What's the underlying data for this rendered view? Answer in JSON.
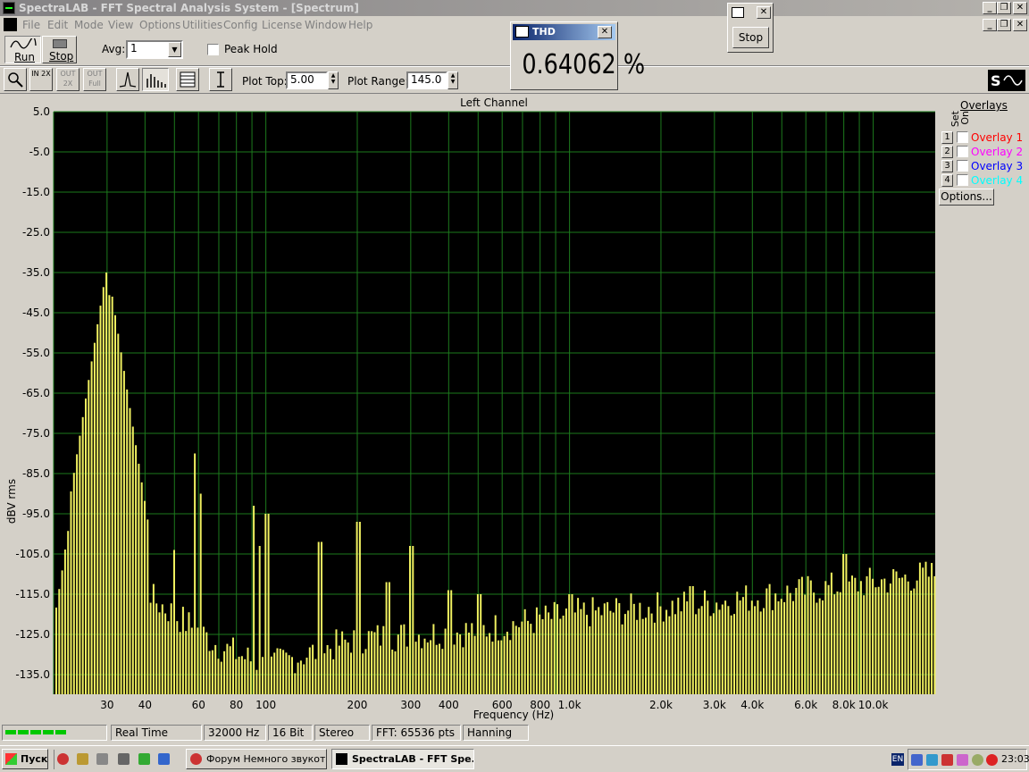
{
  "window": {
    "title": "SpectraLAB - FFT Spectral Analysis System - [Spectrum]"
  },
  "menu": [
    "File",
    "Edit",
    "Mode",
    "View",
    "Options",
    "Utilities",
    "Config",
    "License",
    "Window",
    "Help"
  ],
  "toolbar": {
    "run_label": "Run",
    "stop_label": "Stop",
    "avg_label": "Avg:",
    "avg_value": "1",
    "peak_hold_label": "Peak Hold",
    "plot_top_label": "Plot Top:",
    "plot_top_value": "5.00",
    "plot_range_label": "Plot Range:",
    "plot_range_value": "145.0",
    "zoom_in_label": "IN 2X",
    "zoom_out_label": "OUT 2X",
    "zoom_full_label": "OUT Full"
  },
  "thd": {
    "title": "THD",
    "value": "0.64062 %"
  },
  "stop_window": {
    "button_label": "Stop"
  },
  "chart_data": {
    "type": "bar",
    "title": "Left Channel",
    "xlabel": "Frequency (Hz)",
    "ylabel": "dBV rms",
    "x_scale": "log",
    "xlim": [
      20,
      16000
    ],
    "ylim": [
      -140,
      5
    ],
    "yticks": [
      "5.0",
      "-5.0",
      "-15.0",
      "-25.0",
      "-35.0",
      "-45.0",
      "-55.0",
      "-65.0",
      "-75.0",
      "-85.0",
      "-95.0",
      "-105.0",
      "-115.0",
      "-125.0",
      "-135.0"
    ],
    "ytick_values": [
      5,
      -5,
      -15,
      -25,
      -35,
      -45,
      -55,
      -65,
      -75,
      -85,
      -95,
      -105,
      -115,
      -125,
      -135
    ],
    "xticks": [
      {
        "v": 30,
        "label": "30"
      },
      {
        "v": 40,
        "label": "40"
      },
      {
        "v": 60,
        "label": "60"
      },
      {
        "v": 80,
        "label": "80"
      },
      {
        "v": 100,
        "label": "100"
      },
      {
        "v": 200,
        "label": "200"
      },
      {
        "v": 300,
        "label": "300"
      },
      {
        "v": 400,
        "label": "400"
      },
      {
        "v": 600,
        "label": "600"
      },
      {
        "v": 800,
        "label": "800"
      },
      {
        "v": 1000,
        "label": "1.0k"
      },
      {
        "v": 2000,
        "label": "2.0k"
      },
      {
        "v": 3000,
        "label": "3.0k"
      },
      {
        "v": 4000,
        "label": "4.0k"
      },
      {
        "v": 6000,
        "label": "6.0k"
      },
      {
        "v": 8000,
        "label": "8.0k"
      },
      {
        "v": 10000,
        "label": "10.0k"
      }
    ],
    "grid": true,
    "colors": {
      "background": "#000000",
      "grid": "#1d7a1d",
      "bars": "#f0f060"
    },
    "peaks": [
      {
        "f": 25,
        "db": -75
      },
      {
        "f": 28,
        "db": -51
      },
      {
        "f": 29.5,
        "db": -35
      },
      {
        "f": 31,
        "db": -41
      },
      {
        "f": 33,
        "db": -70
      },
      {
        "f": 35,
        "db": -86
      },
      {
        "f": 50,
        "db": -104
      },
      {
        "f": 58,
        "db": -80
      },
      {
        "f": 60.5,
        "db": -90
      },
      {
        "f": 90,
        "db": -93
      },
      {
        "f": 95,
        "db": -103
      },
      {
        "f": 100,
        "db": -95
      },
      {
        "f": 150,
        "db": -102
      },
      {
        "f": 200,
        "db": -97
      },
      {
        "f": 250,
        "db": -112
      },
      {
        "f": 300,
        "db": -103
      },
      {
        "f": 400,
        "db": -114
      },
      {
        "f": 500,
        "db": -115
      },
      {
        "f": 1000,
        "db": -115
      },
      {
        "f": 2500,
        "db": -113
      },
      {
        "f": 8000,
        "db": -105
      }
    ],
    "noise_floor": [
      {
        "f": 20,
        "db": -120
      },
      {
        "f": 40,
        "db": -115
      },
      {
        "f": 70,
        "db": -128
      },
      {
        "f": 100,
        "db": -133
      },
      {
        "f": 200,
        "db": -126
      },
      {
        "f": 500,
        "db": -124
      },
      {
        "f": 1000,
        "db": -120
      },
      {
        "f": 3000,
        "db": -117
      },
      {
        "f": 10000,
        "db": -112
      },
      {
        "f": 16000,
        "db": -110
      }
    ]
  },
  "overlays": {
    "title": "Overlays",
    "set_label": "Set",
    "on_label": "On",
    "items": [
      {
        "num": "1",
        "label": "Overlay 1",
        "color": "#ff0000"
      },
      {
        "num": "2",
        "label": "Overlay 2",
        "color": "#ff00ff"
      },
      {
        "num": "3",
        "label": "Overlay 3",
        "color": "#0000ff"
      },
      {
        "num": "4",
        "label": "Overlay 4",
        "color": "#00ffff"
      }
    ],
    "options_label": "Options..."
  },
  "status": {
    "mode": "Real Time",
    "rate": "32000 Hz",
    "bits": "16 Bit",
    "channels": "Stereo",
    "fft": "FFT: 65536 pts",
    "window": "Hanning"
  },
  "taskbar": {
    "start_label": "Пуск",
    "tasks": [
      {
        "label": "Форум Немного звукот..."
      },
      {
        "label": "SpectraLAB - FFT Spe..."
      }
    ],
    "lang": "EN",
    "clock": "23:03"
  }
}
